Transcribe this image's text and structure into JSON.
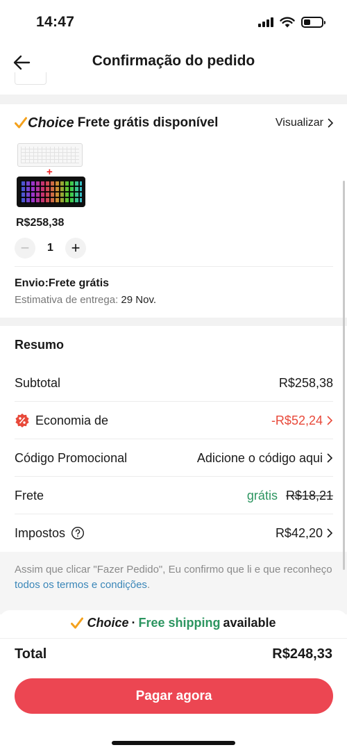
{
  "status_bar": {
    "time": "14:47"
  },
  "header": {
    "title": "Confirmação do pedido"
  },
  "choice": {
    "brand": "Choice",
    "title": "Frete grátis disponível",
    "view_label": "Visualizar",
    "plus": "+",
    "price": "R$258,38",
    "quantity": "1",
    "shipping_label": "Envio:Frete grátis",
    "eta_label": "Estimativa de entrega:",
    "eta_date": "29 Nov."
  },
  "summary": {
    "title": "Resumo",
    "subtotal_label": "Subtotal",
    "subtotal_value": "R$258,38",
    "savings_label": "Economia de",
    "savings_value": "-R$52,24",
    "promo_label": "Código Promocional",
    "promo_value": "Adicione o código aqui",
    "shipping_label": "Frete",
    "shipping_free": "grátis",
    "shipping_original": "R$18,21",
    "taxes_label": "Impostos",
    "taxes_value": "R$42,20"
  },
  "terms": {
    "text": "Assim que clicar \"Fazer Pedido\", Eu confirmo que li e que reconheço ",
    "link": "todos os termos e condições",
    "end": "."
  },
  "bottom": {
    "brand": "Choice",
    "separator": "·",
    "free_shipping": "Free shipping",
    "available": "available",
    "total_label": "Total",
    "total_value": "R$248,33",
    "pay_label": "Pagar agora"
  },
  "colors": {
    "accent": "#ec4652",
    "discount": "#e8493a",
    "free": "#2c9560",
    "choice_check": "#f4a11c",
    "link": "#3a86b8"
  },
  "icons": [
    "signal-icon",
    "wifi-icon",
    "battery-icon",
    "back-arrow-icon",
    "choice-check-icon",
    "chevron-right-icon",
    "percent-badge-icon",
    "help-icon"
  ]
}
